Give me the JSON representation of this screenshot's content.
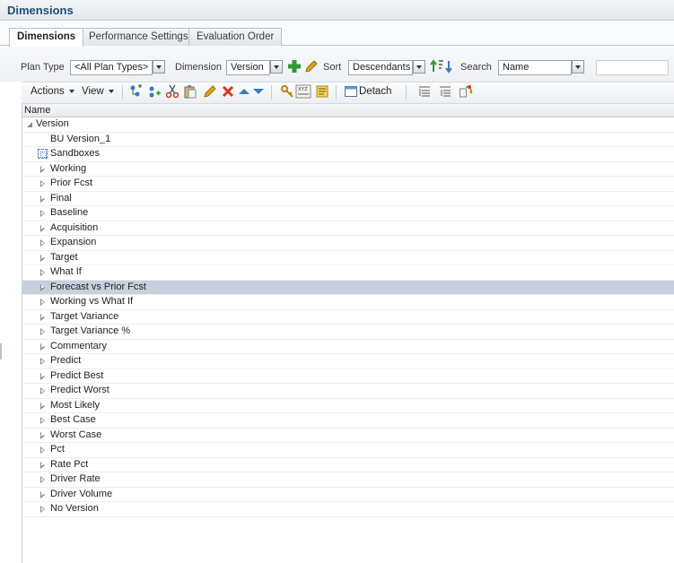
{
  "header": {
    "title": "Dimensions"
  },
  "tabs": [
    {
      "label": "Dimensions",
      "active": true
    },
    {
      "label": "Performance Settings",
      "active": false
    },
    {
      "label": "Evaluation Order",
      "active": false
    }
  ],
  "filters": {
    "plan_type_label": "Plan Type",
    "plan_type_value": "<All Plan Types>",
    "dimension_label": "Dimension",
    "dimension_value": "Version",
    "sort_label": "Sort",
    "sort_value": "Descendants",
    "search_label": "Search",
    "search_field_value": "Name",
    "search_text": ""
  },
  "toolbar": {
    "actions_label": "Actions",
    "view_label": "View",
    "detach_label": "Detach"
  },
  "grid": {
    "column_header": "Name",
    "root": "Version",
    "rows": [
      {
        "label": "BU Version_1",
        "type": "leaf"
      },
      {
        "label": "Sandboxes",
        "type": "sandbox"
      },
      {
        "label": "Working",
        "type": "parent"
      },
      {
        "label": "Prior Fcst",
        "type": "parent"
      },
      {
        "label": "Final",
        "type": "parent"
      },
      {
        "label": "Baseline",
        "type": "parent"
      },
      {
        "label": "Acquisition",
        "type": "parent"
      },
      {
        "label": "Expansion",
        "type": "parent"
      },
      {
        "label": "Target",
        "type": "parent"
      },
      {
        "label": "What If",
        "type": "parent"
      },
      {
        "label": "Forecast vs Prior Fcst",
        "type": "parent",
        "selected": true
      },
      {
        "label": "Working vs What If",
        "type": "parent"
      },
      {
        "label": "Target Variance",
        "type": "parent"
      },
      {
        "label": "Target Variance %",
        "type": "parent"
      },
      {
        "label": "Commentary",
        "type": "parent"
      },
      {
        "label": "Predict",
        "type": "parent"
      },
      {
        "label": "Predict Best",
        "type": "parent"
      },
      {
        "label": "Predict Worst",
        "type": "parent"
      },
      {
        "label": "Most Likely",
        "type": "parent"
      },
      {
        "label": "Best Case",
        "type": "parent"
      },
      {
        "label": "Worst Case",
        "type": "parent"
      },
      {
        "label": "Pct",
        "type": "parent"
      },
      {
        "label": "Rate Pct",
        "type": "parent"
      },
      {
        "label": "Driver Rate",
        "type": "parent"
      },
      {
        "label": "Driver Volume",
        "type": "parent"
      },
      {
        "label": "No Version",
        "type": "parent"
      }
    ]
  },
  "icons": {
    "add": "add-member-icon",
    "edit": "edit-pencil-icon",
    "sort_order": "sort-order-icon",
    "add_child": "add-child-icon",
    "add_sibling": "add-sibling-icon",
    "cut": "cut-icon",
    "paste": "paste-icon",
    "delete": "delete-icon",
    "move_up": "move-up-icon",
    "move_down": "move-down-icon",
    "assign_access": "assign-access-icon",
    "member_formula": "member-formula-icon",
    "smart_list": "smart-list-icon",
    "detach": "detach-icon",
    "collapse_all": "collapse-all-icon",
    "expand_all": "expand-all-icon",
    "refresh": "refresh-icon"
  },
  "colors": {
    "title": "#1f4d75",
    "selection": "#c5d1de",
    "add_green": "#2e9b2e",
    "delete_red": "#d23a2a",
    "arrow_blue": "#3b79c3"
  }
}
